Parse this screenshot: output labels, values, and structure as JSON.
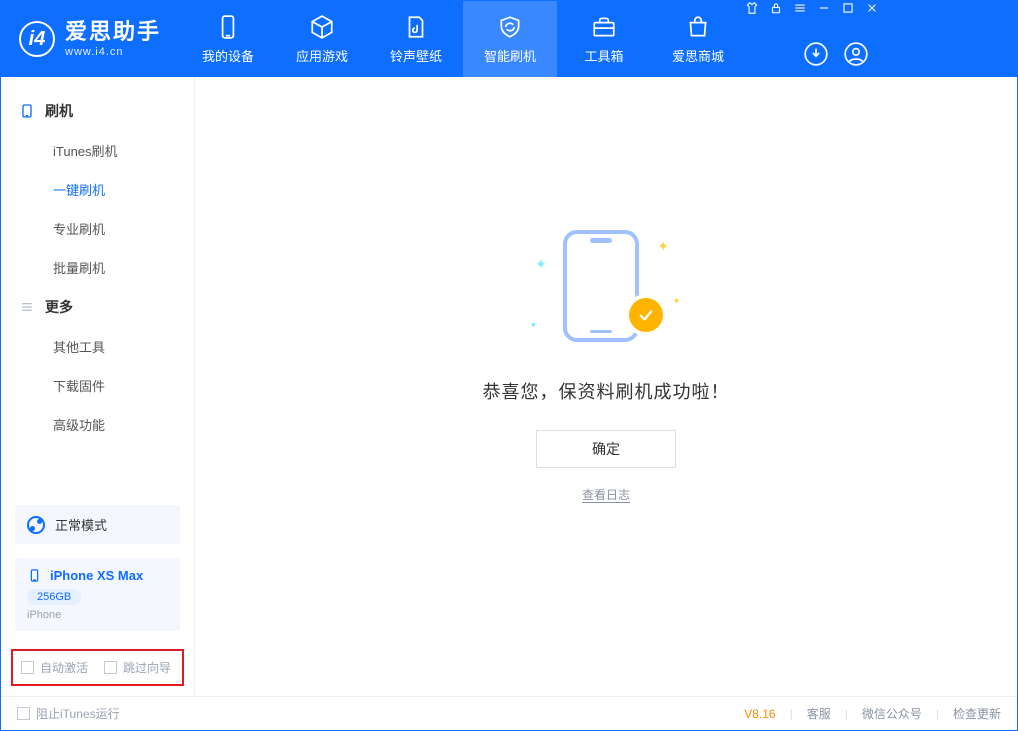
{
  "app": {
    "name": "爱思助手",
    "site": "www.i4.cn"
  },
  "tabs": {
    "device": "我的设备",
    "apps": "应用游戏",
    "ring": "铃声壁纸",
    "flash": "智能刷机",
    "tools": "工具箱",
    "store": "爱思商城"
  },
  "sidebar": {
    "section_flash": "刷机",
    "items_flash": {
      "itunes": "iTunes刷机",
      "onekey": "一键刷机",
      "pro": "专业刷机",
      "batch": "批量刷机"
    },
    "section_more": "更多",
    "items_more": {
      "other": "其他工具",
      "fw": "下载固件",
      "adv": "高级功能"
    }
  },
  "mode": {
    "label": "正常模式"
  },
  "device": {
    "name": "iPhone XS Max",
    "capacity": "256GB",
    "type": "iPhone"
  },
  "redbox": {
    "auto_activate": "自动激活",
    "skip_guide": "跳过向导"
  },
  "main": {
    "message": "恭喜您，保资料刷机成功啦！",
    "ok": "确定",
    "view_log": "查看日志"
  },
  "status": {
    "block_itunes": "阻止iTunes运行",
    "version": "V8.16",
    "cs": "客服",
    "wechat": "微信公众号",
    "update": "检查更新"
  }
}
